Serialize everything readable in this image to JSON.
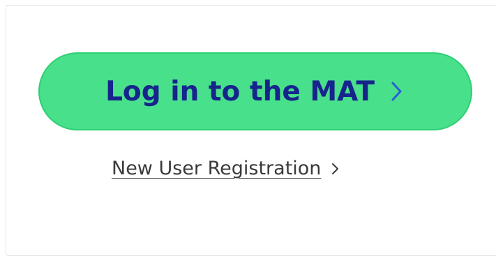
{
  "login": {
    "label": "Log in to the MAT",
    "icon": "chevron-right-icon"
  },
  "register": {
    "label": "New User Registration",
    "icon": "chevron-right-icon"
  },
  "colors": {
    "button_bg": "#48e08a",
    "button_text": "#16248c",
    "link_text": "#3a3a3a"
  }
}
